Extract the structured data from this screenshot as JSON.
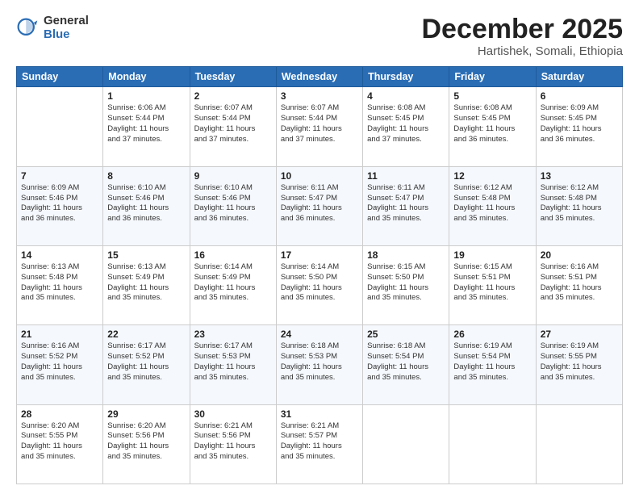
{
  "logo": {
    "general": "General",
    "blue": "Blue"
  },
  "header": {
    "title": "December 2025",
    "subtitle": "Hartishek, Somali, Ethiopia"
  },
  "weekdays": [
    "Sunday",
    "Monday",
    "Tuesday",
    "Wednesday",
    "Thursday",
    "Friday",
    "Saturday"
  ],
  "weeks": [
    [
      {
        "day": "",
        "info": ""
      },
      {
        "day": "1",
        "info": "Sunrise: 6:06 AM\nSunset: 5:44 PM\nDaylight: 11 hours\nand 37 minutes."
      },
      {
        "day": "2",
        "info": "Sunrise: 6:07 AM\nSunset: 5:44 PM\nDaylight: 11 hours\nand 37 minutes."
      },
      {
        "day": "3",
        "info": "Sunrise: 6:07 AM\nSunset: 5:44 PM\nDaylight: 11 hours\nand 37 minutes."
      },
      {
        "day": "4",
        "info": "Sunrise: 6:08 AM\nSunset: 5:45 PM\nDaylight: 11 hours\nand 37 minutes."
      },
      {
        "day": "5",
        "info": "Sunrise: 6:08 AM\nSunset: 5:45 PM\nDaylight: 11 hours\nand 36 minutes."
      },
      {
        "day": "6",
        "info": "Sunrise: 6:09 AM\nSunset: 5:45 PM\nDaylight: 11 hours\nand 36 minutes."
      }
    ],
    [
      {
        "day": "7",
        "info": "Sunrise: 6:09 AM\nSunset: 5:46 PM\nDaylight: 11 hours\nand 36 minutes."
      },
      {
        "day": "8",
        "info": "Sunrise: 6:10 AM\nSunset: 5:46 PM\nDaylight: 11 hours\nand 36 minutes."
      },
      {
        "day": "9",
        "info": "Sunrise: 6:10 AM\nSunset: 5:46 PM\nDaylight: 11 hours\nand 36 minutes."
      },
      {
        "day": "10",
        "info": "Sunrise: 6:11 AM\nSunset: 5:47 PM\nDaylight: 11 hours\nand 36 minutes."
      },
      {
        "day": "11",
        "info": "Sunrise: 6:11 AM\nSunset: 5:47 PM\nDaylight: 11 hours\nand 35 minutes."
      },
      {
        "day": "12",
        "info": "Sunrise: 6:12 AM\nSunset: 5:48 PM\nDaylight: 11 hours\nand 35 minutes."
      },
      {
        "day": "13",
        "info": "Sunrise: 6:12 AM\nSunset: 5:48 PM\nDaylight: 11 hours\nand 35 minutes."
      }
    ],
    [
      {
        "day": "14",
        "info": "Sunrise: 6:13 AM\nSunset: 5:48 PM\nDaylight: 11 hours\nand 35 minutes."
      },
      {
        "day": "15",
        "info": "Sunrise: 6:13 AM\nSunset: 5:49 PM\nDaylight: 11 hours\nand 35 minutes."
      },
      {
        "day": "16",
        "info": "Sunrise: 6:14 AM\nSunset: 5:49 PM\nDaylight: 11 hours\nand 35 minutes."
      },
      {
        "day": "17",
        "info": "Sunrise: 6:14 AM\nSunset: 5:50 PM\nDaylight: 11 hours\nand 35 minutes."
      },
      {
        "day": "18",
        "info": "Sunrise: 6:15 AM\nSunset: 5:50 PM\nDaylight: 11 hours\nand 35 minutes."
      },
      {
        "day": "19",
        "info": "Sunrise: 6:15 AM\nSunset: 5:51 PM\nDaylight: 11 hours\nand 35 minutes."
      },
      {
        "day": "20",
        "info": "Sunrise: 6:16 AM\nSunset: 5:51 PM\nDaylight: 11 hours\nand 35 minutes."
      }
    ],
    [
      {
        "day": "21",
        "info": "Sunrise: 6:16 AM\nSunset: 5:52 PM\nDaylight: 11 hours\nand 35 minutes."
      },
      {
        "day": "22",
        "info": "Sunrise: 6:17 AM\nSunset: 5:52 PM\nDaylight: 11 hours\nand 35 minutes."
      },
      {
        "day": "23",
        "info": "Sunrise: 6:17 AM\nSunset: 5:53 PM\nDaylight: 11 hours\nand 35 minutes."
      },
      {
        "day": "24",
        "info": "Sunrise: 6:18 AM\nSunset: 5:53 PM\nDaylight: 11 hours\nand 35 minutes."
      },
      {
        "day": "25",
        "info": "Sunrise: 6:18 AM\nSunset: 5:54 PM\nDaylight: 11 hours\nand 35 minutes."
      },
      {
        "day": "26",
        "info": "Sunrise: 6:19 AM\nSunset: 5:54 PM\nDaylight: 11 hours\nand 35 minutes."
      },
      {
        "day": "27",
        "info": "Sunrise: 6:19 AM\nSunset: 5:55 PM\nDaylight: 11 hours\nand 35 minutes."
      }
    ],
    [
      {
        "day": "28",
        "info": "Sunrise: 6:20 AM\nSunset: 5:55 PM\nDaylight: 11 hours\nand 35 minutes."
      },
      {
        "day": "29",
        "info": "Sunrise: 6:20 AM\nSunset: 5:56 PM\nDaylight: 11 hours\nand 35 minutes."
      },
      {
        "day": "30",
        "info": "Sunrise: 6:21 AM\nSunset: 5:56 PM\nDaylight: 11 hours\nand 35 minutes."
      },
      {
        "day": "31",
        "info": "Sunrise: 6:21 AM\nSunset: 5:57 PM\nDaylight: 11 hours\nand 35 minutes."
      },
      {
        "day": "",
        "info": ""
      },
      {
        "day": "",
        "info": ""
      },
      {
        "day": "",
        "info": ""
      }
    ]
  ]
}
